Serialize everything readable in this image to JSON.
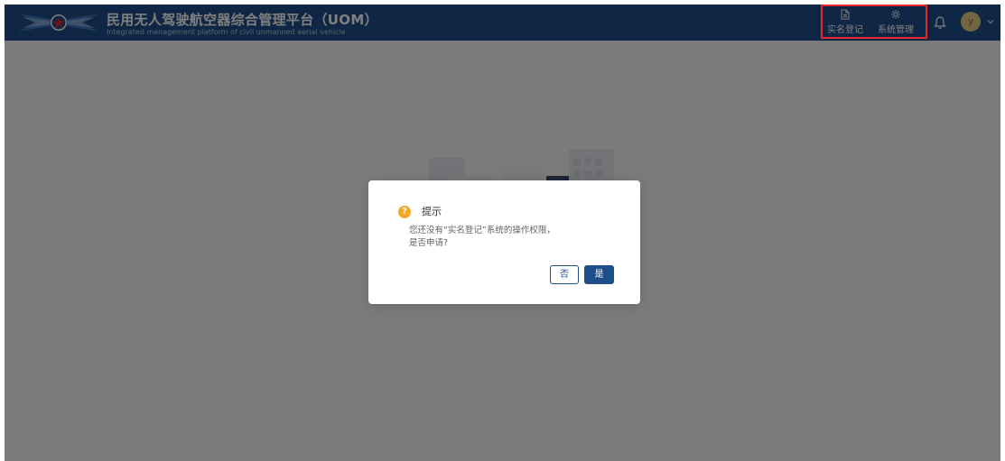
{
  "header": {
    "title_cn": "民用无人驾驶航空器综合管理平台（UOM）",
    "title_en": "Integrated management platform of civil unmanned aerial vehicle",
    "nav": [
      {
        "label": "实名登记",
        "icon": "document-icon"
      },
      {
        "label": "系统管理",
        "icon": "settings-icon"
      }
    ],
    "avatar_letter": "y"
  },
  "dialog": {
    "title": "提示",
    "icon_glyph": "?",
    "message_line1": "您还没有“实名登记”系统的操作权限，",
    "message_line2": "是否申请?",
    "no_label": "否",
    "yes_label": "是"
  },
  "colors": {
    "header_bg": "#1f4f8a",
    "highlight": "#e8282e",
    "warning": "#f5a623",
    "primary": "#1f4f8a"
  }
}
